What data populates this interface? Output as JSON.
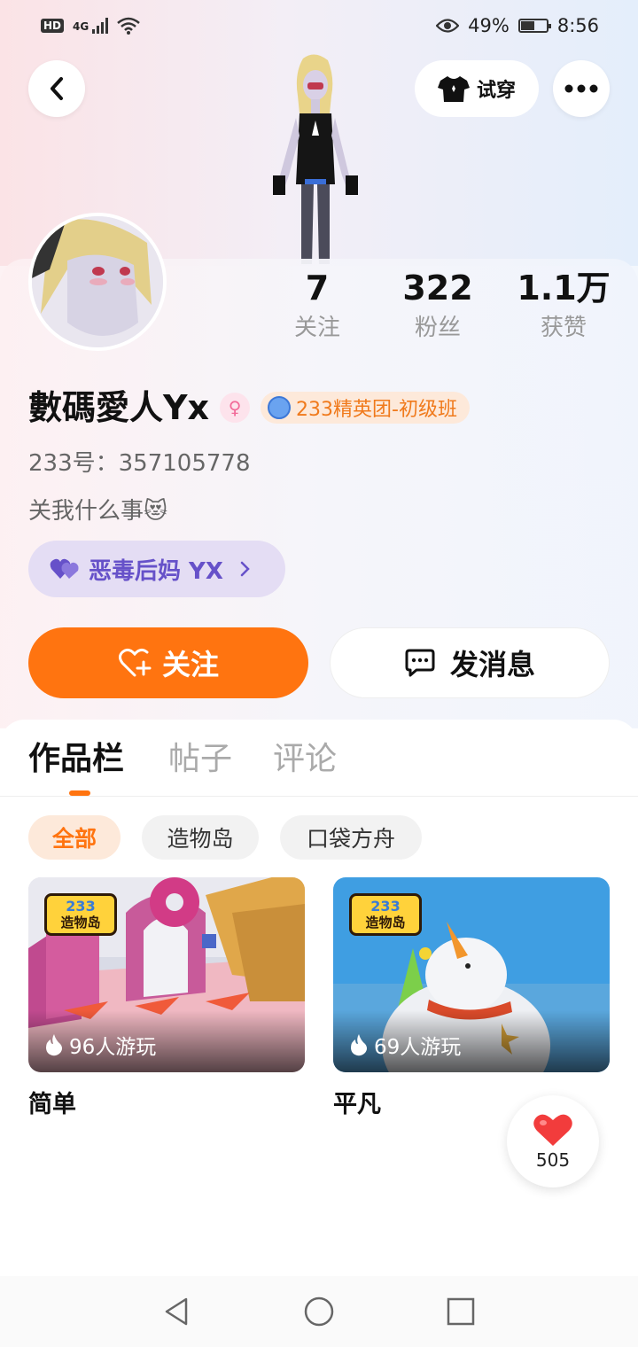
{
  "status_bar": {
    "battery": "49%",
    "time": "8:56",
    "hd": "HD",
    "network": "4G"
  },
  "header": {
    "try_on_label": "试穿"
  },
  "stats": [
    {
      "value": "7",
      "label": "关注"
    },
    {
      "value": "322",
      "label": "粉丝"
    },
    {
      "value": "1.1万",
      "label": "获赞"
    }
  ],
  "profile": {
    "username": "數碼愛人Yx",
    "rank_badge": "233精英团-初级班",
    "uid": "233号：357105778",
    "bio": "关我什么事😻",
    "partner_tag": "恶毒后妈 YX"
  },
  "actions": {
    "follow_label": "关注",
    "message_label": "发消息"
  },
  "tabs": [
    {
      "label": "作品栏"
    },
    {
      "label": "帖子"
    },
    {
      "label": "评论"
    }
  ],
  "filters": [
    {
      "label": "全部"
    },
    {
      "label": "造物岛"
    },
    {
      "label": "口袋方舟"
    }
  ],
  "games": [
    {
      "title": "简单",
      "plays": "96人游玩",
      "logo_num": "233",
      "logo_text": "造物岛"
    },
    {
      "title": "平凡",
      "plays": "69人游玩",
      "logo_num": "233",
      "logo_text": "造物岛"
    }
  ],
  "like_fab": {
    "count": "505"
  },
  "colors": {
    "accent": "#ff7410",
    "partner": "#6651c9"
  }
}
